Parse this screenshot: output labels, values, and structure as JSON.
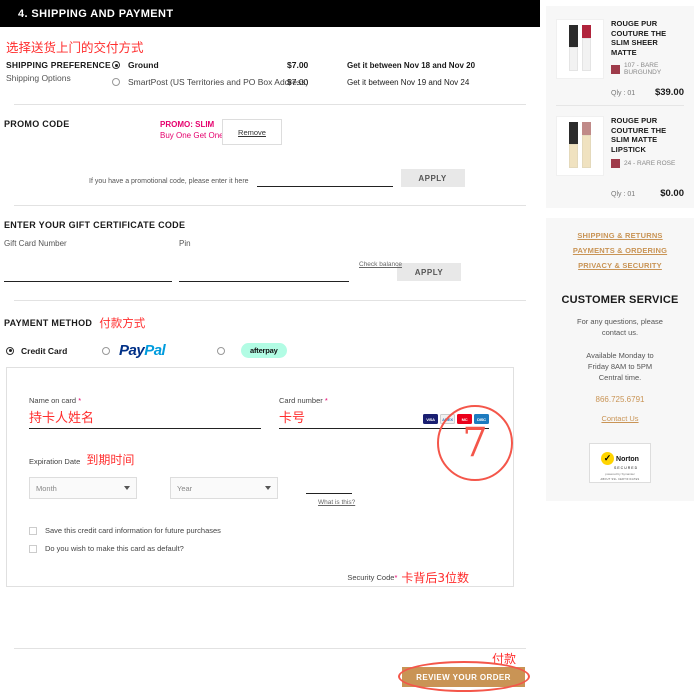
{
  "section": {
    "header": "4.  SHIPPING AND PAYMENT"
  },
  "shipping": {
    "cn_heading": "选择送货上门的交付方式",
    "label": "SHIPPING PREFERENCE",
    "sub_label": "Shipping Options",
    "options": [
      {
        "name": "Ground",
        "price": "$7.00",
        "eta": "Get it between Nov 18 and Nov 20",
        "selected": true
      },
      {
        "name": "SmartPost (US Territories and PO Box Address)",
        "price": "$7.00",
        "eta": "Get it between Nov 19 and Nov 24",
        "selected": false
      }
    ]
  },
  "promo": {
    "title": "PROMO CODE",
    "applied_code": "PROMO: SLIM",
    "applied_desc": "Buy One Get One",
    "remove_label": "Remove",
    "hint": "If you have a promotional code, please enter it here",
    "input_value": "",
    "apply_label": "APPLY"
  },
  "gift": {
    "title": "ENTER YOUR GIFT CERTIFICATE CODE",
    "card_number_label": "Gift Card Number",
    "pin_label": "Pin",
    "card_number_value": "",
    "pin_value": "",
    "check_balance": "Check balance",
    "apply_label": "APPLY"
  },
  "payment": {
    "title": "PAYMENT METHOD",
    "cn_title": "付款方式",
    "methods": [
      {
        "label": "Credit Card",
        "selected": true
      },
      {
        "label": "PayPal",
        "selected": false
      },
      {
        "label": "afterpay",
        "selected": false
      }
    ],
    "paypal_part1": "Pay",
    "paypal_part2": "Pal",
    "afterpay_label": "afterpay",
    "card_form": {
      "name_label": "Name on card",
      "name_cn": "持卡人姓名",
      "name_value": "",
      "number_label": "Card number",
      "number_cn": "卡号",
      "number_value": "",
      "expiration_label": "Expiration Date",
      "expiration_cn": "到期时间",
      "month_placeholder": "Month",
      "year_placeholder": "Year",
      "security_label": "Security Code",
      "security_cn": "卡背后3位数",
      "security_value": "",
      "what_is_this": "What is this?",
      "brands": [
        "VISA",
        "AMEX",
        "MC",
        "DISC"
      ],
      "checkbox_save": "Save this credit card information for future purchases",
      "checkbox_default": "Do you wish to make this card as default?"
    }
  },
  "annotations": {
    "step_number": "7",
    "pay_cn": "付款",
    "accent_red": "#f4564a"
  },
  "footer": {
    "review_label": "REVIEW YOUR ORDER",
    "button_color": "#c99455"
  },
  "cart": {
    "items": [
      {
        "name": "ROUGE PUR COUTURE THE SLIM SHEER MATTE",
        "shade": "107 - BARE BURGUNDY",
        "swatch": "#9e3b4a",
        "qty": "Qly : 01",
        "price": "$39.00",
        "cap_color": "#2b2b2b",
        "body_color": "#f2f2f2",
        "bullet_color": "#b0243c"
      },
      {
        "name": "ROUGE PUR COUTURE THE SLIM MATTE LIPSTICK",
        "shade": "24 - RARE ROSE",
        "swatch": "#9e3b4a",
        "qty": "Qly : 01",
        "price": "$0.00",
        "cap_color": "#2b2b2b",
        "body_color": "#f0e2c0",
        "bullet_color": "#c08a88"
      }
    ]
  },
  "help": {
    "links": [
      "SHIPPING & RETURNS",
      "PAYMENTS & ORDERING",
      "PRIVACY & SECURITY"
    ],
    "cs_title": "CUSTOMER SERVICE",
    "cs_text_line1": "For any questions, please",
    "cs_text_line2": "contact us.",
    "hours_line1": "Available Monday to",
    "hours_line2": "Friday 8AM to 5PM",
    "hours_line3": "Central time.",
    "phone": "866.725.6791",
    "contact_link": "Contact Us",
    "link_color": "#c99455",
    "norton": {
      "word": "Norton",
      "secured": "SECURED",
      "powered": "powered by Symantec",
      "about": "ABOUT SSL CERTIFICATES"
    }
  }
}
